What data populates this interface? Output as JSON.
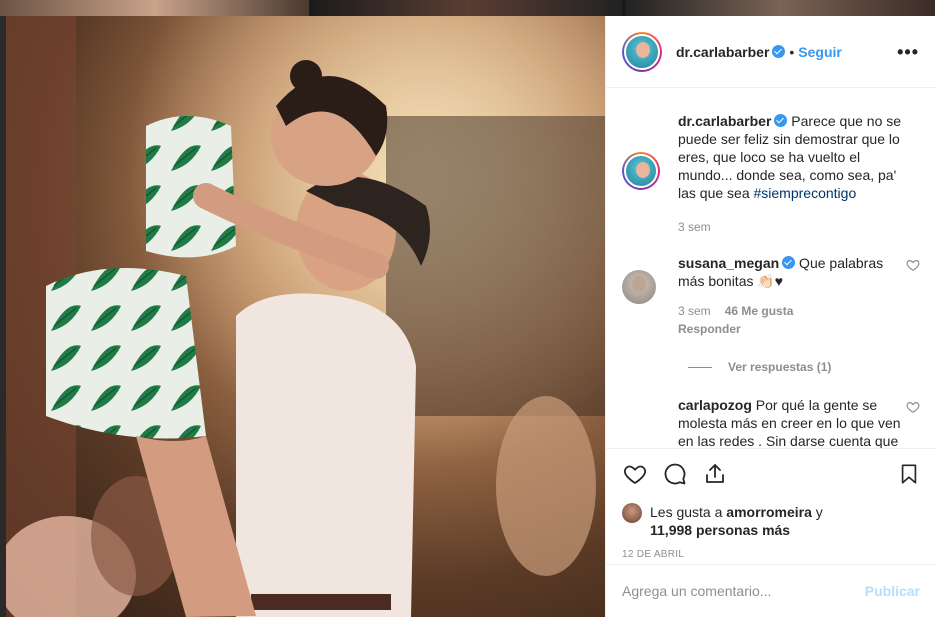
{
  "post": {
    "username": "dr.carlabarber",
    "separator": "•",
    "follow_label": "Seguir",
    "more_label": "•••"
  },
  "caption": {
    "username": "dr.carlabarber",
    "text": " Parece que no se puede ser feliz sin demostrar que lo eres, que loco se ha vuelto el mundo... donde sea, como sea, pa' las que sea ",
    "hashtag": "#siemprecontigo",
    "time": "3 sem"
  },
  "comments": [
    {
      "username": "susana_megan",
      "text": " Que palabras más bonitas 👏🏻♥",
      "time": "3 sem",
      "likes": "46 Me gusta",
      "reply_label": "Responder"
    },
    {
      "username": "carlapozog",
      "text": " Por qué la gente se molesta más en creer en lo que ven en las redes . Sin darse cuenta que ... la envidia f"
    }
  ],
  "view_replies": "Ver respuestas (1)",
  "likes": {
    "prefix": "Les gusta a ",
    "user": "amorromeira",
    "middle": " y",
    "count": "11,998 personas más"
  },
  "date": "12 DE ABRIL",
  "comment_box": {
    "placeholder": "Agrega un comentario...",
    "publish_label": "Publicar"
  },
  "colors": {
    "accent": "#3897f0",
    "publish_disabled": "#b2dffc",
    "muted": "#8e8e8e",
    "text": "#262626"
  },
  "icons": [
    "heart-icon",
    "comment-icon",
    "share-icon",
    "bookmark-icon",
    "verified-badge-icon",
    "more-options-icon"
  ]
}
